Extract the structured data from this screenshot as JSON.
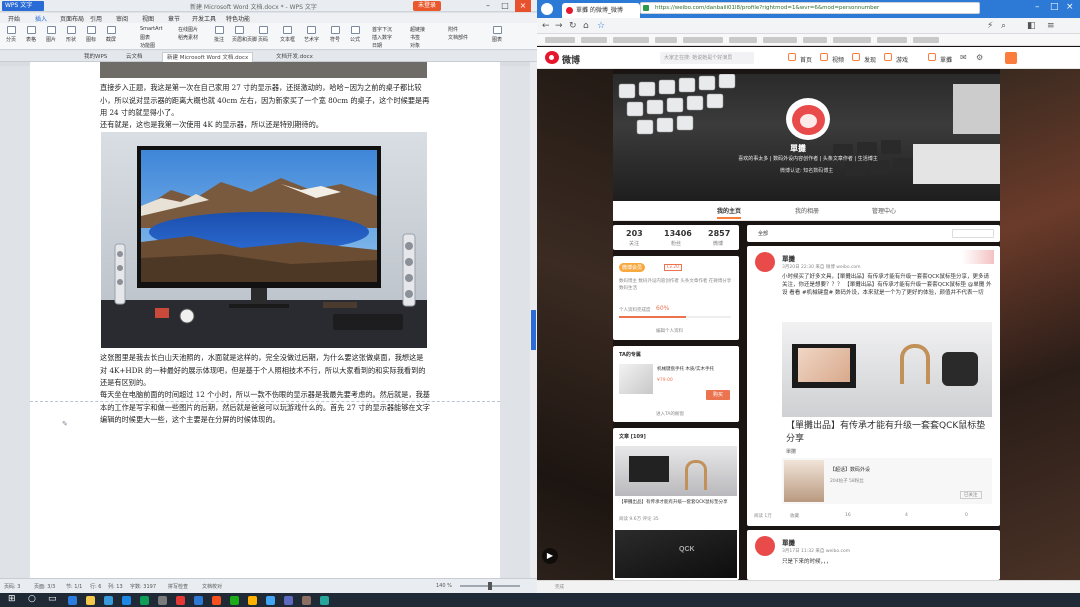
{
  "wps": {
    "app_title": "WPS 文字",
    "doc_title": "新建 Microsoft Word 文档.docx * - WPS 文字",
    "login_btn": "未登录",
    "menu": [
      "开始",
      "插入",
      "页面布局",
      "引用",
      "审阅",
      "视图",
      "章节",
      "开发工具",
      "特色功能"
    ],
    "menu_active_index": 1,
    "ribbon": [
      "分页",
      "表格",
      "图片",
      "形状",
      "图标",
      "截屏",
      "图表",
      "文本框",
      "艺术字",
      "符号",
      "公式",
      "超链接",
      "书签",
      "对象",
      "附件",
      "文档部件",
      "页码",
      "页眉和页脚"
    ],
    "ribbon_small": [
      "SmartArt",
      "图表",
      "功能图",
      "在线图片",
      "稻壳素材",
      "批注",
      "首字下沉",
      "插入数字",
      "日期",
      "对象"
    ],
    "doc_tabs": [
      "我的WPS",
      "云文档",
      "新建 Microsoft Word 文档.docx",
      "文档开发.docx"
    ],
    "active_doc_tab": 2,
    "paragraphs": [
      "直接步入正题，我这是第一次在自己家用 27 寸的显示器，还挺激动的，哈哈~因为之前的桌子都比较小，所以说对显示器的距离大概也就 40cm 左右，因为新家买了一个宽 80cm 的桌子，这个时候要是再用 24 寸的就显得小了。",
      "还有就是，这也是我第一次使用 4K 的显示器，所以还是特别期待的。",
      "这张图里是我去长白山天池照的，水面就是这样的，完全没做过后期，为什么要这张做桌面，我想这是对 4K+HDR 的一种最好的展示体现吧，但是基于个人照相技术不行，所以大家看到的和实际我看到的还是有区别的。",
      "每天坐在电脑前面的时间超过 12 个小时，所以一款不伤眼的显示器是我最先要考虑的。然后就是，我基本的工作是写字和做一些图片的后期，然后就是爸爸可以玩游戏什么的。首先 27 寸的显示器能够在文字编辑的时候更大一些，这个主要是在分屏的时候体现的。"
    ],
    "status": [
      "页码: 3",
      "页面: 3/3",
      "节: 1/1",
      "行: 6",
      "列: 13",
      "字数: 3197",
      "拼写检查",
      "文档校对"
    ],
    "zoom": "140 %"
  },
  "browser": {
    "tab_title": "單攤 的微博_微博",
    "url": "https://weibo.com/danbaili01l8/profile?rightmod=1&wvr=6&mod=personnumber",
    "search_placeholder": "大家正在搜: 她说她是个好演员",
    "nav": [
      "首页",
      "视频",
      "发现",
      "游戏",
      "單攤"
    ],
    "profile": {
      "name": "單攤",
      "bio": "喜欢的事太多 | 数码外设内容创作者 | 头条文章作者 | 生活博主",
      "intro": "微博认证: 知名数码博主"
    },
    "tabs": [
      "我的主页",
      "我的相册",
      "管理中心"
    ],
    "stats": [
      {
        "num": "203",
        "label": "关注"
      },
      {
        "num": "13406",
        "label": "粉丝"
      },
      {
        "num": "2857",
        "label": "微博"
      }
    ],
    "level_card": {
      "badge": "微博会员",
      "level": "Lv.20",
      "text": "数码博主 数码外设内容创作者 头条文章作者 在微博分享数码生活",
      "progress_label": "个人资料完成度",
      "progress": "60%",
      "progress_value": 0.6,
      "link": "编辑个人资料"
    },
    "ta_card": {
      "title": "TA的专属",
      "item": "机械键盘手托 木质/实木手托",
      "price": "¥79.00",
      "btn": "购买",
      "link": "进入TA的橱窗"
    },
    "article_card": {
      "title": "文章 [109]",
      "item": "【單攤出品】有传承才能有升级一套套QCK鼠标垫分享",
      "meta": "阅读 9.6万  评论 35"
    },
    "feed": {
      "filter": "全部",
      "post1": {
        "name": "單攤",
        "time": "3月20日 22:30 来自 微博 weibo.com",
        "text": "小时候买了好多文具，【單攤出品】有传承才能有升级一套套QCK鼠标垫分享，更多请关注，你还是想要？？？ 【單攤出品】有传承才能有升级一套套QCK鼠标垫 @单攤 外设 看看 #机械键盘# 数码外设，本来就是一个为了更好的体验，颜值并不代表一切",
        "article_title": "【單攤出品】有传承才能有升级一套套QCK鼠标垫分享",
        "author": "單攤",
        "quote_title": "【超话】数码外设",
        "quote_meta": "204帖子 58粉丝",
        "follow": "已关注",
        "actions": [
          "收藏",
          "转发",
          "16",
          "4",
          "0"
        ],
        "reads": "阅读 1万"
      },
      "post2": {
        "name": "單攤",
        "time": "3月17日 11:32 来自 weibo.com",
        "text": "只是下来的时候，，，"
      }
    },
    "watermark": "值 什么值得买",
    "status": "完成"
  },
  "colors": {
    "wps_blue": "#2b6bd6",
    "weibo_red": "#e6162d",
    "weibo_orange": "#fa7d3c",
    "taskbar": "#1f2a36"
  }
}
